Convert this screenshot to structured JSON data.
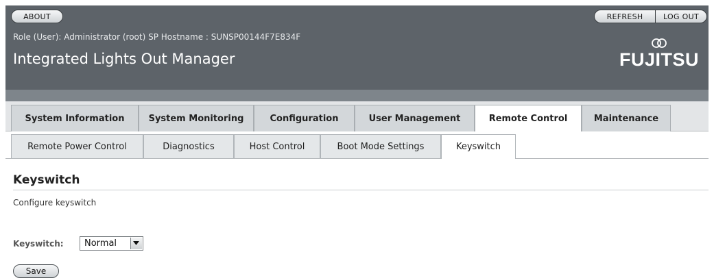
{
  "header": {
    "about_label": "ABOUT",
    "refresh_label": "REFRESH",
    "logout_label": "LOG OUT",
    "role_line": "Role (User): Administrator (root)   SP Hostname : SUNSP00144F7E834F",
    "app_title": "Integrated Lights Out Manager",
    "brand": "FUJITSU"
  },
  "primary_tabs": [
    {
      "label": "System Information"
    },
    {
      "label": "System Monitoring"
    },
    {
      "label": "Configuration"
    },
    {
      "label": "User Management"
    },
    {
      "label": "Remote Control",
      "active": true
    },
    {
      "label": "Maintenance"
    }
  ],
  "secondary_tabs": [
    {
      "label": "Remote Power Control"
    },
    {
      "label": "Diagnostics"
    },
    {
      "label": "Host Control"
    },
    {
      "label": "Boot Mode Settings"
    },
    {
      "label": "Keyswitch",
      "active": true
    }
  ],
  "content": {
    "title": "Keyswitch",
    "description": "Configure keyswitch",
    "keyswitch_label": "Keyswitch:",
    "keyswitch_value": "Normal",
    "save_label": "Save"
  },
  "colors": {
    "masthead": "#5d6369",
    "active_tab": "#ffffff",
    "inactive_tab": "#d3d7da"
  },
  "icons": {
    "select_arrow": "triangle-down",
    "brand_mark": "infinity-loop"
  }
}
